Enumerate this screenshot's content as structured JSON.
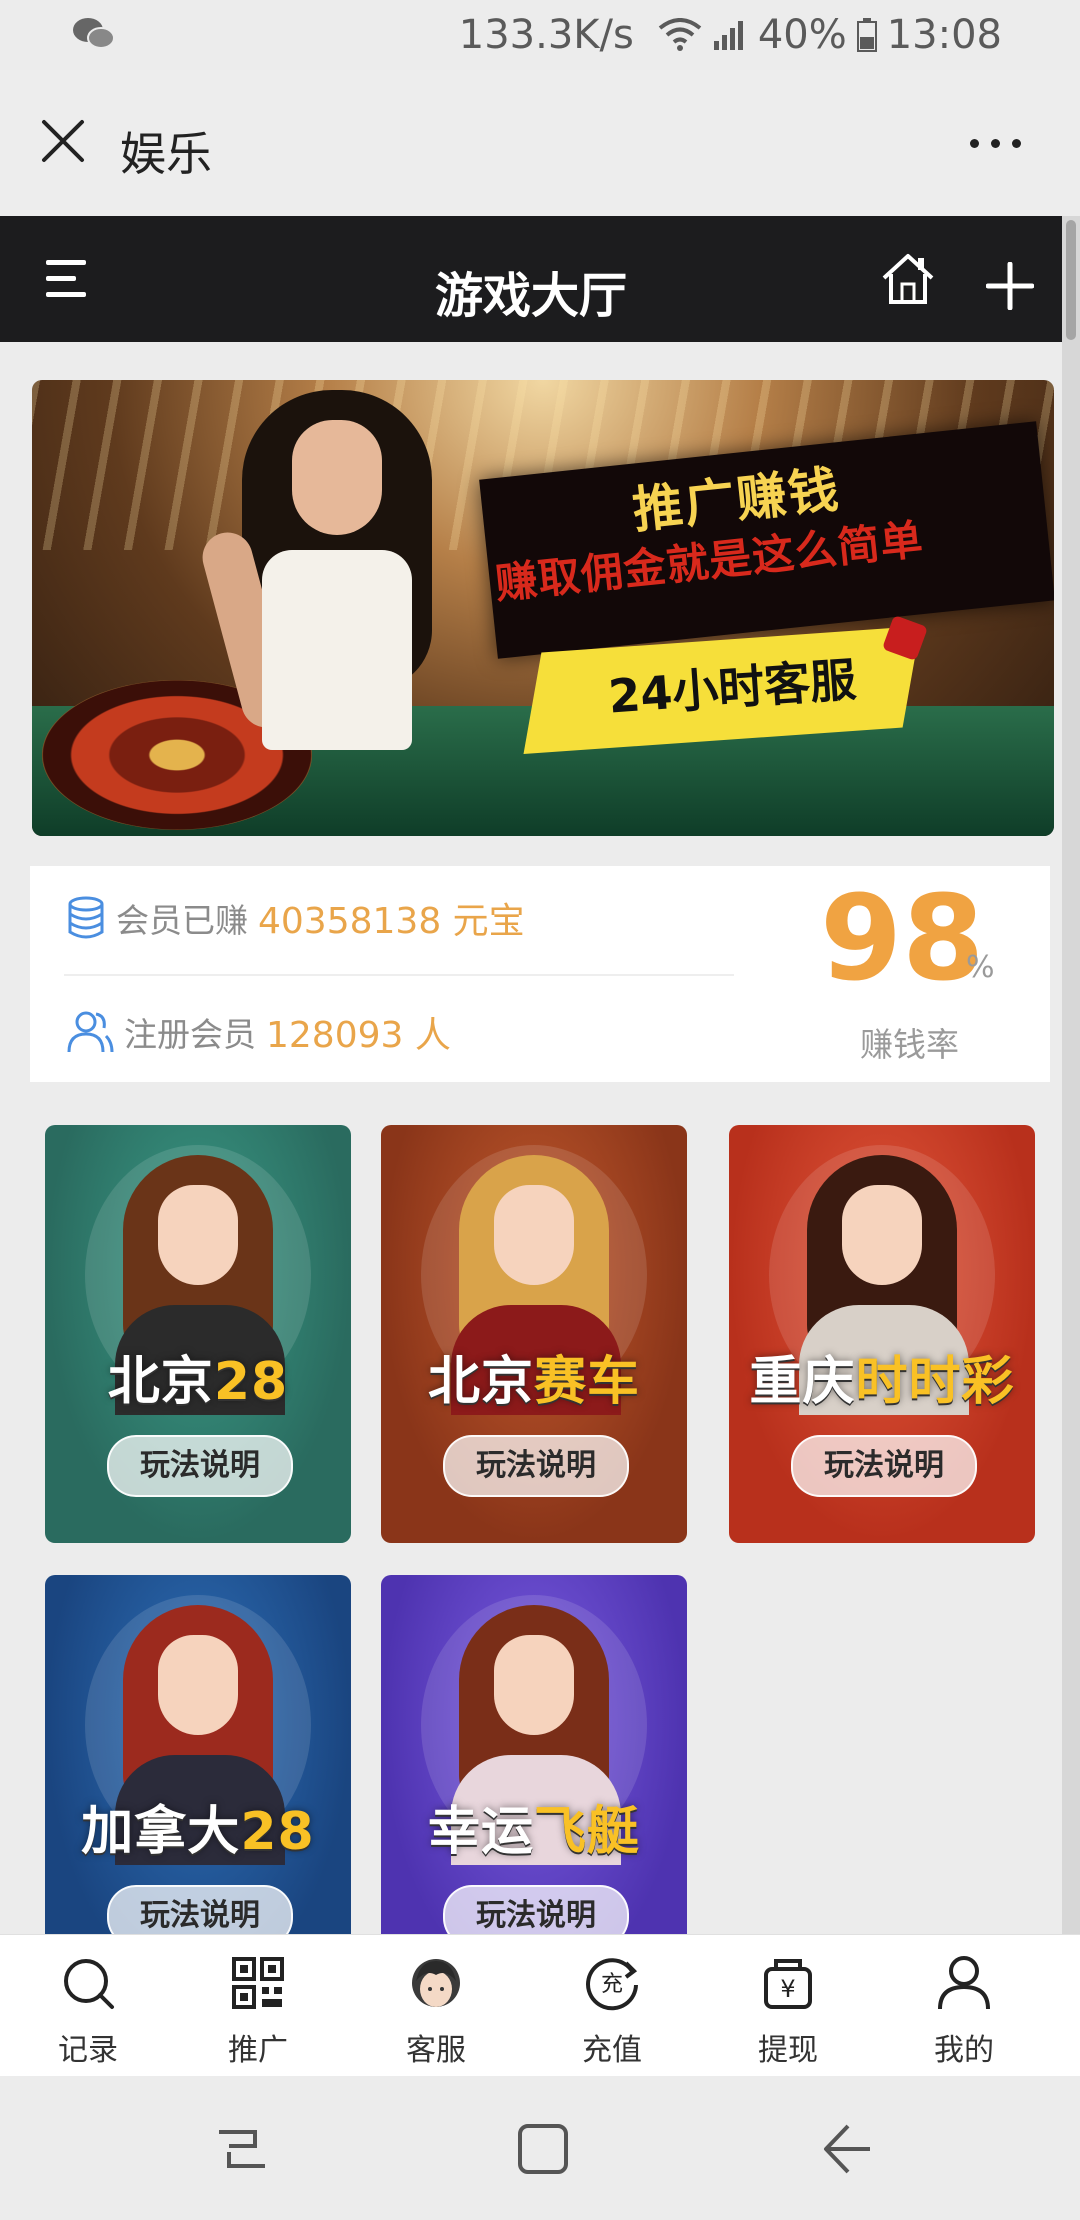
{
  "status_bar": {
    "net_speed": "133.3K/s",
    "battery": "40%",
    "time": "13:08"
  },
  "wechat_bar": {
    "title": "娱乐"
  },
  "app_header": {
    "title": "游戏大厅"
  },
  "banner": {
    "line1": "推广赚钱",
    "line2": "赚取佣金就是这么简单",
    "line3": "24小时客服"
  },
  "stats": {
    "earned_label": "会员已赚",
    "earned_value": "40358138 元宝",
    "members_label": "注册会员",
    "members_value": "128093 人",
    "rate_value": "98",
    "rate_unit": "%",
    "rate_label": "赚钱率"
  },
  "games": [
    {
      "name_a": "北京",
      "name_b": "28",
      "button": "玩法说明",
      "bg": "#2a6b5f"
    },
    {
      "name_a": "北京",
      "name_b": "赛车",
      "button": "玩法说明",
      "bg": "#9a3f1f"
    },
    {
      "name_a": "重庆",
      "name_b": "时时彩",
      "button": "玩法说明",
      "bg": "#c43a22"
    },
    {
      "name_a": "加拿大",
      "name_b": "28",
      "button": "玩法说明",
      "bg": "#1f4f8c"
    },
    {
      "name_a": "幸运",
      "name_b": "飞艇",
      "button": "玩法说明",
      "bg": "#5b3fbf"
    }
  ],
  "tabs": [
    {
      "label": "记录",
      "icon": "search-icon"
    },
    {
      "label": "推广",
      "icon": "qrcode-icon"
    },
    {
      "label": "客服",
      "icon": "customer-service-icon"
    },
    {
      "label": "充值",
      "icon": "recharge-icon"
    },
    {
      "label": "提现",
      "icon": "withdraw-icon"
    },
    {
      "label": "我的",
      "icon": "user-icon"
    }
  ]
}
